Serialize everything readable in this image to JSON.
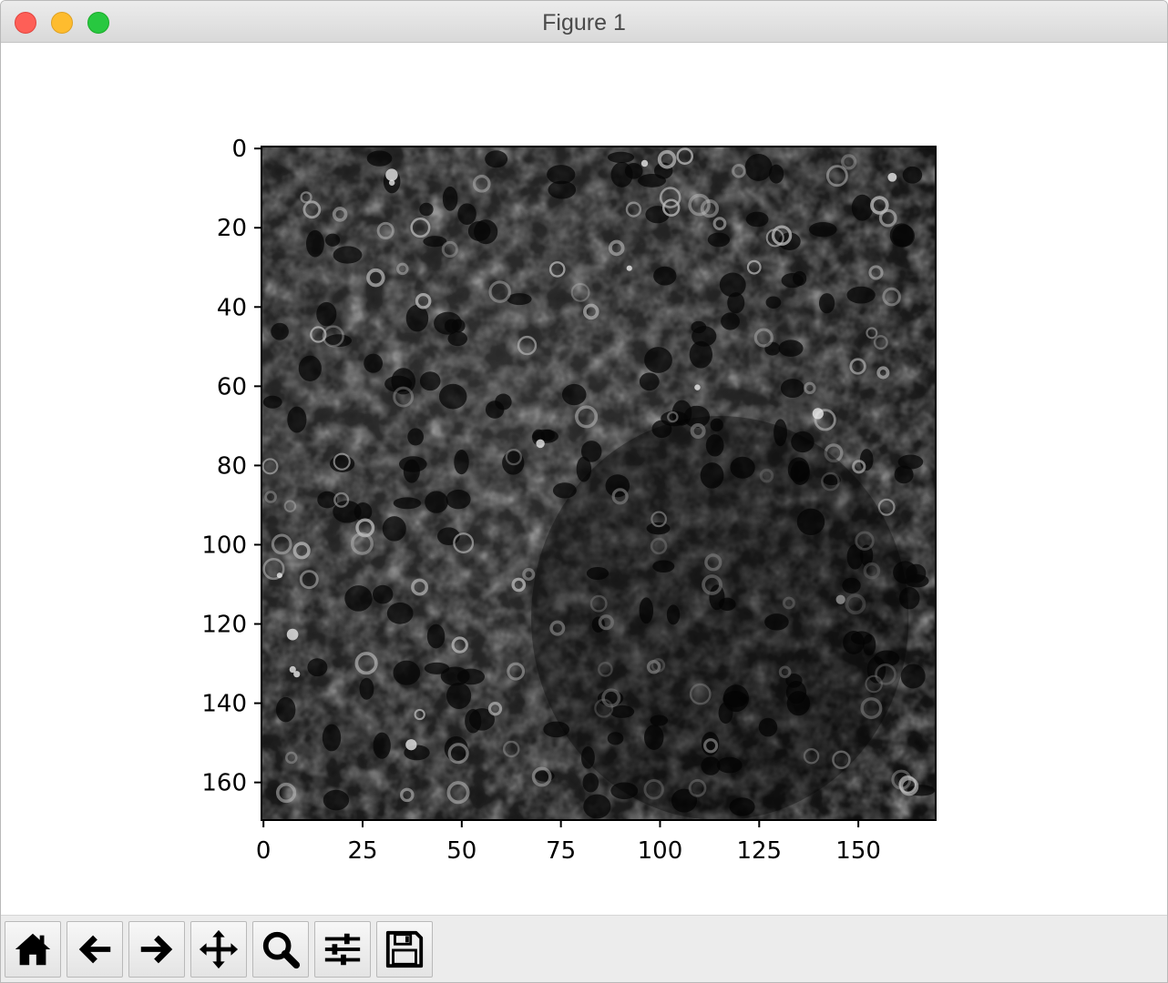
{
  "window": {
    "title": "Figure 1"
  },
  "toolbar": {
    "buttons": [
      {
        "name": "home-button",
        "icon": "home-icon"
      },
      {
        "name": "back-button",
        "icon": "arrow-left-icon"
      },
      {
        "name": "forward-button",
        "icon": "arrow-right-icon"
      },
      {
        "name": "pan-button",
        "icon": "move-icon"
      },
      {
        "name": "zoom-button",
        "icon": "magnifier-icon"
      },
      {
        "name": "configure-subplots-button",
        "icon": "sliders-icon"
      },
      {
        "name": "save-button",
        "icon": "floppy-disk-icon"
      }
    ]
  },
  "chart_data": {
    "type": "heatmap",
    "colormap": "gray",
    "title": "",
    "xlabel": "",
    "ylabel": "",
    "xlim": [
      -0.5,
      169.5
    ],
    "ylim": [
      169.5,
      -0.5
    ],
    "x_ticks": [
      0,
      25,
      50,
      75,
      100,
      125,
      150
    ],
    "y_ticks": [
      0,
      20,
      40,
      60,
      80,
      100,
      120,
      140,
      160
    ],
    "x_tick_labels": [
      "0",
      "25",
      "50",
      "75",
      "100",
      "125",
      "150"
    ],
    "y_tick_labels": [
      "0",
      "20",
      "40",
      "60",
      "80",
      "100",
      "120",
      "140",
      "160"
    ]
  }
}
